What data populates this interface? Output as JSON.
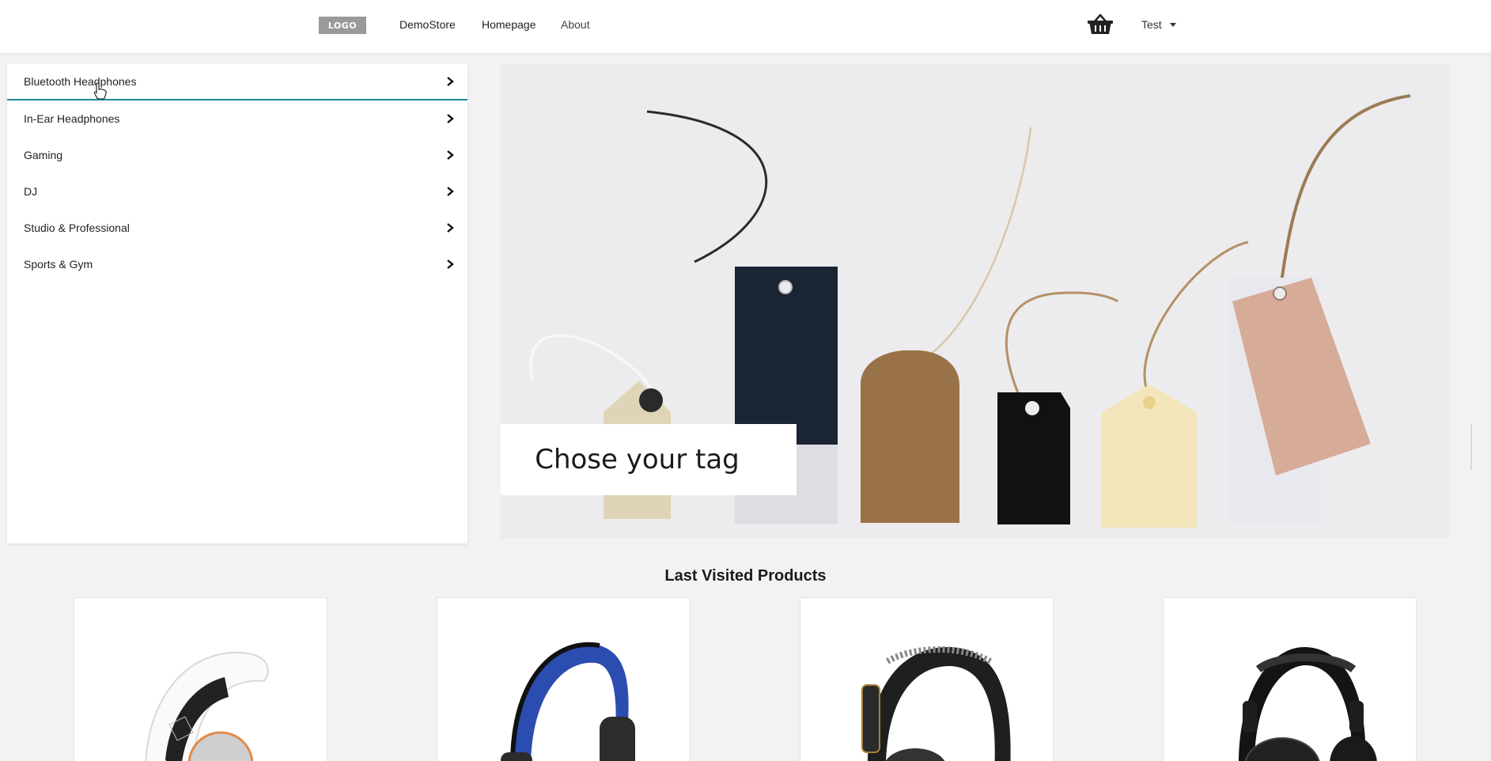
{
  "header": {
    "logo_text": "LOGO",
    "nav": [
      "DemoStore",
      "Homepage",
      "About"
    ],
    "cart_icon": "basket-icon",
    "user_label": "Test"
  },
  "sidebar": {
    "items": [
      {
        "label": "Bluetooth Headphones",
        "active": true
      },
      {
        "label": "In-Ear Headphones"
      },
      {
        "label": "Gaming"
      },
      {
        "label": "DJ"
      },
      {
        "label": "Studio & Professional"
      },
      {
        "label": "Sports & Gym"
      }
    ],
    "accent_color": "#1b8a98"
  },
  "hero": {
    "caption": "Chose your tag"
  },
  "last_visited": {
    "title": "Last Visited Products",
    "products": [
      {
        "image": "white-headphones"
      },
      {
        "image": "blue-headphones"
      },
      {
        "image": "black-headphones"
      },
      {
        "image": "gaming-headphones"
      }
    ]
  }
}
